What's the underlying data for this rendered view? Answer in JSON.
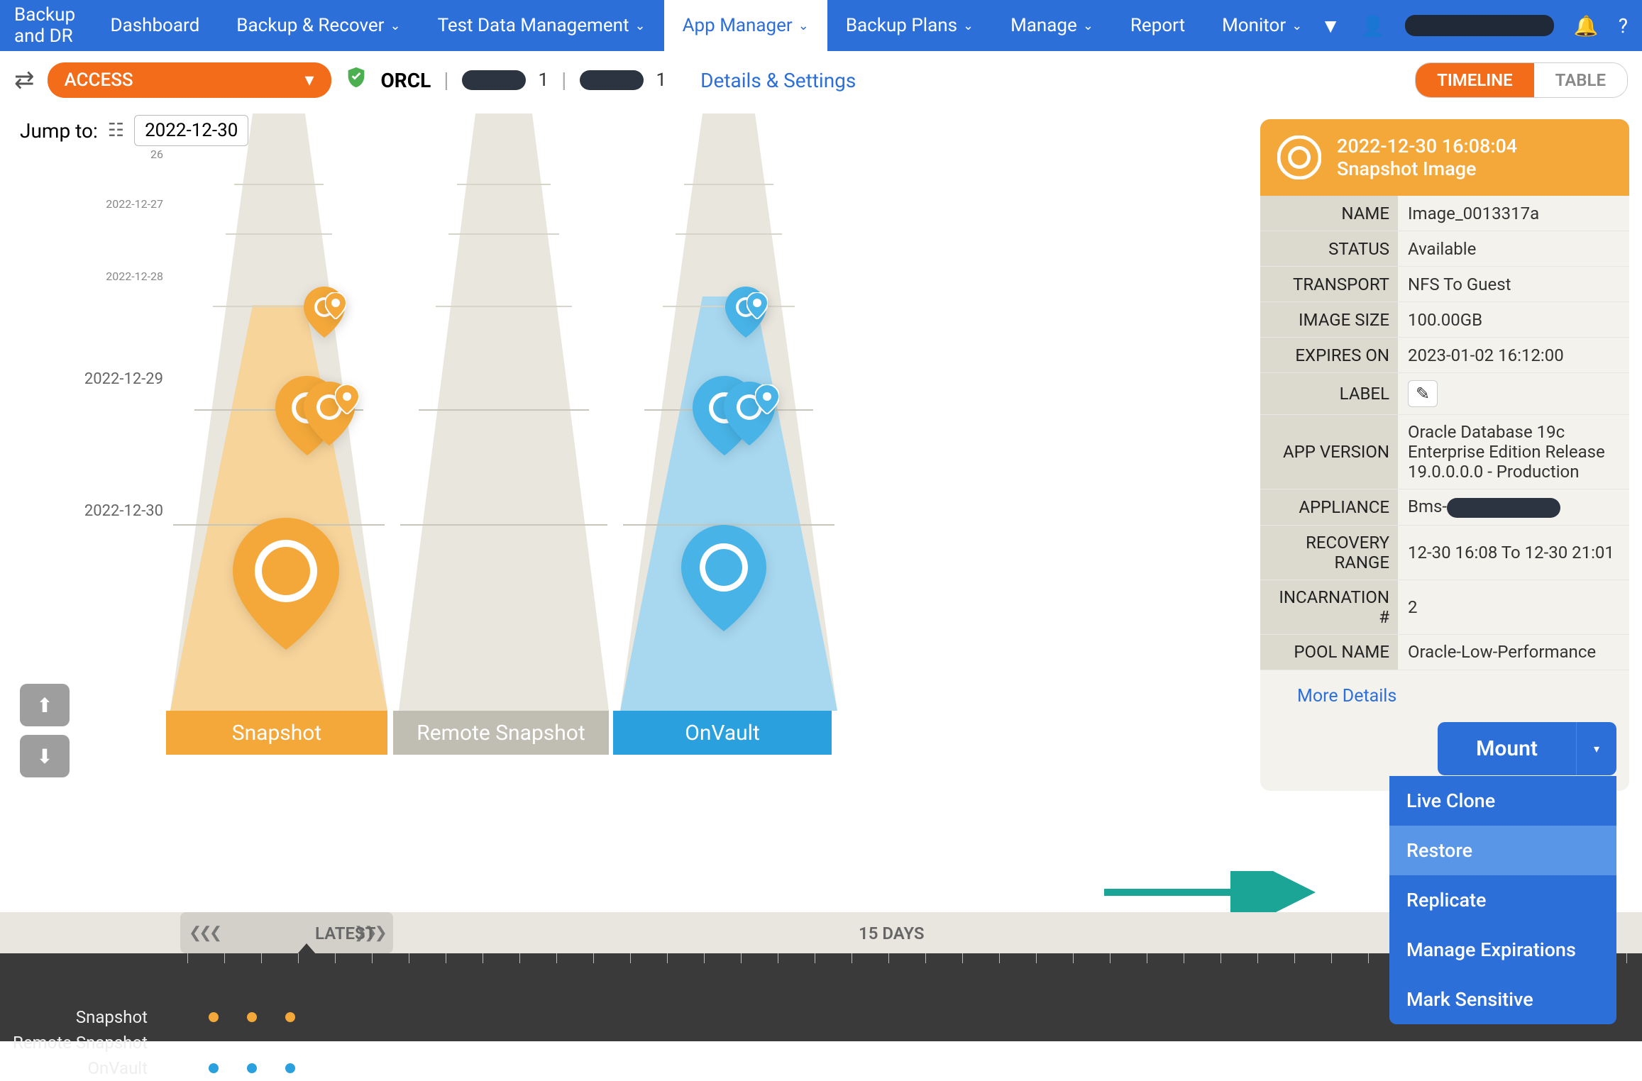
{
  "appTitle": "Backup and DR",
  "nav": {
    "items": [
      {
        "label": "Dashboard",
        "dropdown": false
      },
      {
        "label": "Backup & Recover",
        "dropdown": true
      },
      {
        "label": "Test Data Management",
        "dropdown": true
      },
      {
        "label": "App Manager",
        "dropdown": true,
        "active": true
      },
      {
        "label": "Backup Plans",
        "dropdown": true
      },
      {
        "label": "Manage",
        "dropdown": true
      },
      {
        "label": "Report",
        "dropdown": false
      },
      {
        "label": "Monitor",
        "dropdown": true
      }
    ]
  },
  "subbar": {
    "access": "ACCESS",
    "db": "ORCL",
    "host1suffix": "1",
    "host2suffix": "1",
    "details": "Details & Settings",
    "timeline": "TIMELINE",
    "table": "TABLE"
  },
  "jump": {
    "label": "Jump to:",
    "date": "2022-12-30"
  },
  "dateLabels": {
    "d26": "26",
    "d27": "2022-12-27",
    "d28": "2022-12-28",
    "d29": "2022-12-29",
    "d30": "2022-12-30"
  },
  "lanes": {
    "snapshot": "Snapshot",
    "remote": "Remote Snapshot",
    "onvault": "OnVault"
  },
  "panel": {
    "timestamp": "2022-12-30  16:08:04",
    "type": "Snapshot Image",
    "rows": {
      "name_k": "NAME",
      "name_v": "Image_0013317a",
      "status_k": "STATUS",
      "status_v": "Available",
      "transport_k": "TRANSPORT",
      "transport_v": "NFS To Guest",
      "size_k": "IMAGE SIZE",
      "size_v": "100.00GB",
      "expires_k": "EXPIRES ON",
      "expires_v": "2023-01-02 16:12:00",
      "label_k": "LABEL",
      "appver_k": "APP VERSION",
      "appver_v": "Oracle Database 19c Enterprise Edition Release 19.0.0.0.0 - Production",
      "appliance_k": "APPLIANCE",
      "appliance_v_prefix": "Bms-",
      "recovery_k": "RECOVERY RANGE",
      "recovery_v": "12-30 16:08 To 12-30 21:01",
      "incarn_k": "INCARNATION #",
      "incarn_v": "2",
      "pool_k": "POOL NAME",
      "pool_v": "Oracle-Low-Performance"
    },
    "moreDetails": "More Details"
  },
  "mount": {
    "label": "Mount",
    "menu": [
      "Live Clone",
      "Restore",
      "Replicate",
      "Manage Expirations",
      "Mark Sensitive"
    ]
  },
  "scrubber": {
    "latest": "LATEST",
    "days15": "15 DAYS",
    "lanes": [
      "Snapshot",
      "Remote Snapshot",
      "OnVault"
    ]
  }
}
